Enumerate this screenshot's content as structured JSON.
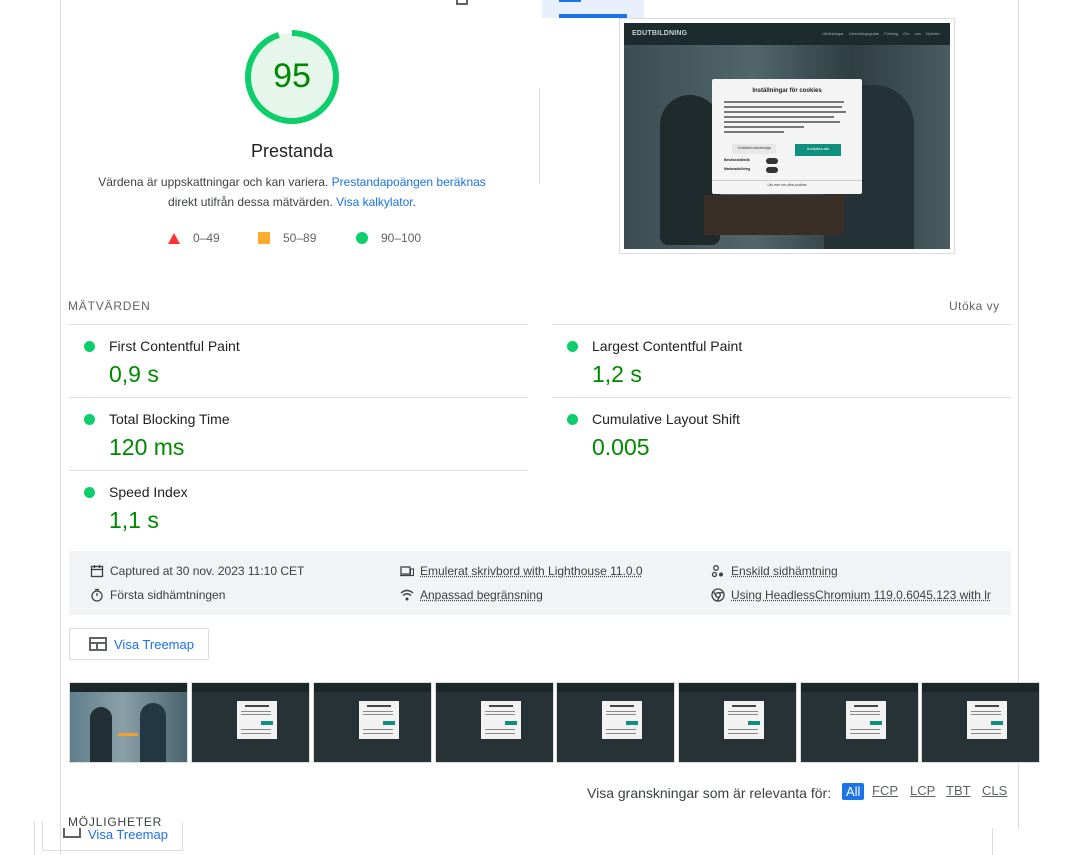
{
  "score": {
    "value": "95",
    "fraction": 0.95,
    "label": "Prestanda",
    "color": "#008800",
    "description_prefix": "Värdena är uppskattningar och kan variera. ",
    "description_link": "Prestandapoängen beräknas",
    "description_mid": "direkt utifrån dessa mätvärden. ",
    "calculator_link": "Visa kalkylator",
    "description_end": "."
  },
  "legend": [
    {
      "shape": "triangle",
      "range": "0–49",
      "color": "#ff3333"
    },
    {
      "shape": "square",
      "range": "50–89",
      "color": "#ffaa33"
    },
    {
      "shape": "circle",
      "range": "90–100",
      "color": "#0cce6b"
    }
  ],
  "screenshot": {
    "logo": "EDUTBILDNING",
    "nav": "Utbildningar Utvecklingsguide Företag Om oss Nyheter",
    "cookie_title": "Inställningar för cookies",
    "cookie_button_secondary": "Godkänd nödvändiga",
    "cookie_button_primary": "Acceptera alla",
    "toggle_1": "Besöksstatistik",
    "toggle_2": "Marknadsföring",
    "cookie_footer": "Läs mer om våra cookies"
  },
  "metrics": {
    "section_label": "MÄTVÄRDEN",
    "expand_label": "Utöka vy",
    "items": [
      {
        "name": "First Contentful Paint",
        "value": "0,9 s"
      },
      {
        "name": "Largest Contentful Paint",
        "value": "1,2 s"
      },
      {
        "name": "Total Blocking Time",
        "value": "120 ms"
      },
      {
        "name": "Cumulative Layout Shift",
        "value": "0.005"
      },
      {
        "name": "Speed Index",
        "value": "1,1 s"
      }
    ]
  },
  "runtime": {
    "captured": "Captured at 30 nov. 2023 11:10 CET",
    "emulation": "Emulerat skrivbord with Lighthouse 11.0.0",
    "session": "Enskild sidhämtning",
    "first_load": "Första sidhämtningen",
    "throttling": "Anpassad begränsning",
    "browser": "Using HeadlessChromium 119.0.6045.123 with lr"
  },
  "treemap_button": "Visa Treemap",
  "audits_filter": {
    "label": "Visa granskningar som är relevanta för:",
    "chips": [
      "All",
      "FCP",
      "LCP",
      "TBT",
      "CLS"
    ]
  },
  "opportunities_label": "MÖJLIGHETER",
  "ghost_treemap_button": "Visa Treemap"
}
